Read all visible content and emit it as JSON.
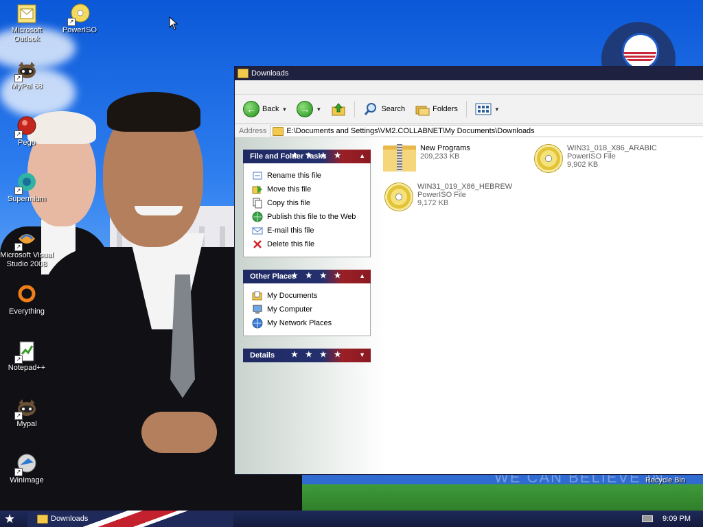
{
  "desktop": {
    "icons": [
      {
        "label": "Microsoft\nOutlook",
        "icon": "outlook-icon"
      },
      {
        "label": "PowerISO",
        "icon": "poweriso-icon"
      },
      {
        "label": "MyPal 68",
        "icon": "mypal-icon"
      },
      {
        "label": "Pego",
        "icon": "pego-icon"
      },
      {
        "label": "Supermium",
        "icon": "supermium-icon"
      },
      {
        "label": "Microsoft Visual\nStudio 2008",
        "icon": "visual-studio-icon"
      },
      {
        "label": "Everything",
        "icon": "everything-icon"
      },
      {
        "label": "Notepad++",
        "icon": "notepadpp-icon"
      },
      {
        "label": "Mypal",
        "icon": "mypal-icon"
      },
      {
        "label": "WinImage",
        "icon": "winimage-icon"
      }
    ],
    "recycle_bin": "Recycle Bin",
    "wallpaper_text": "WE CAN BELIEVE IN"
  },
  "window": {
    "title": "Downloads",
    "toolbar": {
      "back": "Back",
      "search": "Search",
      "folders": "Folders"
    },
    "address": {
      "label": "Address",
      "value": "E:\\Documents and Settings\\VM2.COLLABNET\\My Documents\\Downloads"
    },
    "tasks_panel": {
      "title": "File and Folder Tasks",
      "items": [
        {
          "label": "Rename this file",
          "icon": "rename-icon"
        },
        {
          "label": "Move this file",
          "icon": "move-icon"
        },
        {
          "label": "Copy this file",
          "icon": "copy-icon"
        },
        {
          "label": "Publish this file to the Web",
          "icon": "web-publish-icon"
        },
        {
          "label": "E-mail this file",
          "icon": "email-icon"
        },
        {
          "label": "Delete this file",
          "icon": "delete-icon"
        }
      ]
    },
    "places_panel": {
      "title": "Other Places",
      "items": [
        {
          "label": "My Documents",
          "icon": "my-documents-icon"
        },
        {
          "label": "My Computer",
          "icon": "my-computer-icon"
        },
        {
          "label": "My Network Places",
          "icon": "network-places-icon"
        }
      ]
    },
    "details_panel": {
      "title": "Details"
    },
    "files": [
      {
        "name": "New Programs",
        "type": "",
        "size": "209,233 KB",
        "icon": "zip-folder-icon"
      },
      {
        "name": "WIN31_018_X86_ARABIC",
        "type": "PowerISO File",
        "size": "9,902 KB",
        "icon": "poweriso-disc-icon"
      },
      {
        "name": "WIN31_019_X86_HEBREW",
        "type": "PowerISO File",
        "size": "9,172 KB",
        "icon": "poweriso-disc-icon"
      }
    ]
  },
  "taskbar": {
    "task_label": "Downloads",
    "clock": "9:09 PM"
  }
}
